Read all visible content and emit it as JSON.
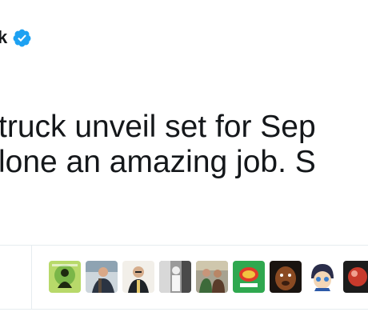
{
  "author": {
    "name_visible": "k",
    "verified_icon": "verified-badge-icon"
  },
  "tweet": {
    "lines": [
      "truck unveil set for Sep",
      "lone an amazing job. S"
    ]
  },
  "likers": {
    "count_visible": 9,
    "avatars": [
      {
        "icon": "avatar-green-logo-icon",
        "color": "#7ab648"
      },
      {
        "icon": "avatar-person-jacket-icon",
        "color": "#3c4a5c"
      },
      {
        "icon": "avatar-bald-man-icon",
        "color": "#d9d2c6"
      },
      {
        "icon": "avatar-bw-figure-icon",
        "color": "#6f6f6f"
      },
      {
        "icon": "avatar-couple-photo-icon",
        "color": "#6b5a3e"
      },
      {
        "icon": "avatar-green-badge-icon",
        "color": "#2fa84f"
      },
      {
        "icon": "avatar-dog-face-icon",
        "color": "#8a4a22"
      },
      {
        "icon": "avatar-anime-character-icon",
        "color": "#e9cfa8"
      },
      {
        "icon": "avatar-red-partial-icon",
        "color": "#c83a2c"
      }
    ]
  }
}
